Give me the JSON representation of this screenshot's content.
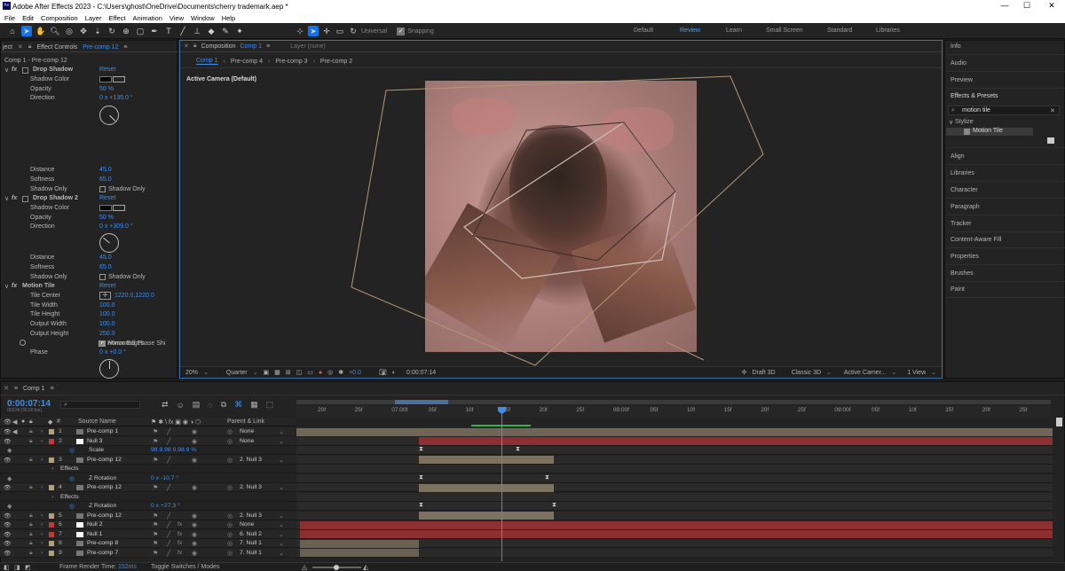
{
  "window": {
    "app_logo": "Ae",
    "title": "Adobe After Effects 2023 - C:\\Users\\ghost\\OneDrive\\Documents\\cherry trademark.aep *",
    "minimize": "—",
    "maximize": "☐",
    "close": "✕"
  },
  "menu": [
    "File",
    "Edit",
    "Composition",
    "Layer",
    "Effect",
    "Animation",
    "View",
    "Window",
    "Help"
  ],
  "toolbar": {
    "universal": "Universal",
    "snapping": "Snapping"
  },
  "workspaces": [
    "Default",
    "Review",
    "Learn",
    "Small Screen",
    "Standard",
    "Libraries"
  ],
  "project_tab": "ject",
  "effect_controls": {
    "tab_label": "Effect Controls",
    "tab_target": "Pre-comp 12",
    "breadcrumb": "Comp 1 - Pre-comp 12",
    "drop_shadow": {
      "name": "Drop Shadow",
      "reset": "Reset",
      "shadow_color": "Shadow Color",
      "opacity": "Opacity",
      "opacity_val": "50 %",
      "direction": "Direction",
      "direction_val": "0 x +135.0 °",
      "distance": "Distance",
      "distance_val": "45.0",
      "softness": "Softness",
      "softness_val": "65.0",
      "shadow_only": "Shadow Only",
      "shadow_only_cb": "Shadow Only"
    },
    "drop_shadow2": {
      "name": "Drop Shadow 2",
      "reset": "Reset",
      "shadow_color": "Shadow Color",
      "opacity": "Opacity",
      "opacity_val": "50 %",
      "direction": "Direction",
      "direction_val": "0 x +309.0 °",
      "distance": "Distance",
      "distance_val": "45.0",
      "softness": "Softness",
      "softness_val": "65.0",
      "shadow_only": "Shadow Only",
      "shadow_only_cb": "Shadow Only"
    },
    "motion_tile": {
      "name": "Motion Tile",
      "reset": "Reset",
      "tile_center": "Tile Center",
      "tile_center_val": "1220.0,1220.0",
      "tile_width": "Tile Width",
      "tile_width_val": "100.0",
      "tile_height": "Tile Height",
      "tile_height_val": "100.0",
      "output_width": "Output Width",
      "output_width_val": "100.0",
      "output_height": "Output Height",
      "output_height_val": "250.0",
      "mirror_edges": "Mirror Edges",
      "phase": "Phase",
      "phase_val": "0 x +0.0 °",
      "horiz_phase": "Horizontal Phase Shi"
    }
  },
  "composition": {
    "tab_label": "Composition",
    "tab_target": "Comp 1",
    "layer_tab": "Layer (none)",
    "nav": [
      "Comp 1",
      "Pre-comp 4",
      "Pre-comp 3",
      "Pre-comp 2"
    ],
    "camera_label": "Active Camera (Default)",
    "footer": {
      "zoom": "20%",
      "resolution": "Quarter",
      "exposure": "+0.0",
      "timecode": "0:00:07:14",
      "draft3d": "Draft 3D",
      "renderer": "Classic 3D",
      "camera": "Active Camer...",
      "view": "1 View"
    }
  },
  "right_panel": {
    "info": "Info",
    "audio": "Audio",
    "preview": "Preview",
    "effects_presets": "Effects & Presets",
    "search_value": "motion tile",
    "category": "Stylize",
    "result": "Motion Tile",
    "items": [
      "Align",
      "Libraries",
      "Character",
      "Paragraph",
      "Tracker",
      "Content-Aware Fill",
      "Properties",
      "Brushes",
      "Paint"
    ]
  },
  "timeline": {
    "tab": "Comp 1",
    "timecode": "0:00:07:14",
    "fps": "00224 (30.00 fps)",
    "col_source": "Source Name",
    "col_parent": "Parent & Link",
    "ruler": [
      "20f",
      "25f",
      "07:00f",
      "05f",
      "10f",
      "15f",
      "20f",
      "25f",
      "08:00f",
      "05f",
      "10f",
      "15f",
      "20f",
      "25f",
      "09:00f",
      "05f",
      "10f",
      "15f",
      "20f",
      "25f"
    ],
    "layers": [
      {
        "num": "1",
        "name": "Pre-comp 1",
        "parent": "None",
        "label": "#b0a07e",
        "type": "comp"
      },
      {
        "num": "2",
        "name": "Null 3",
        "parent": "None",
        "label": "#c0393b",
        "type": "null"
      },
      {
        "num": "",
        "name": "Scale",
        "value": "98.9,98.9,98.9 %",
        "type": "prop"
      },
      {
        "num": "3",
        "name": "Pre-comp 12",
        "parent": "2. Null 3",
        "label": "#b0a07e",
        "type": "comp"
      },
      {
        "num": "",
        "name": "Effects",
        "type": "group"
      },
      {
        "num": "",
        "name": "Z Rotation",
        "value": "0 x -10.7 °",
        "type": "prop"
      },
      {
        "num": "4",
        "name": "Pre-comp 12",
        "parent": "2. Null 3",
        "label": "#b0a07e",
        "type": "comp"
      },
      {
        "num": "",
        "name": "Effects",
        "type": "group"
      },
      {
        "num": "",
        "name": "Z Rotation",
        "value": "0 x +27.3 °",
        "type": "prop"
      },
      {
        "num": "5",
        "name": "Pre-comp 12",
        "parent": "2. Null 3",
        "label": "#b0a07e",
        "type": "comp"
      },
      {
        "num": "6",
        "name": "Null 2",
        "parent": "None",
        "label": "#c0393b",
        "type": "null"
      },
      {
        "num": "7",
        "name": "Null 1",
        "parent": "6. Null 2",
        "label": "#c0393b",
        "type": "null"
      },
      {
        "num": "8",
        "name": "Pre-comp 8",
        "parent": "7. Null 1",
        "label": "#b0a07e",
        "type": "comp"
      },
      {
        "num": "9",
        "name": "Pre-comp 7",
        "parent": "7. Null 1",
        "label": "#b0a07e",
        "type": "comp"
      }
    ],
    "footer": {
      "render_label": "Frame Render Time:",
      "render_value": "152ms",
      "toggle": "Toggle Switches / Modes"
    }
  },
  "colors": {
    "accent": "#3d8ff0",
    "null_bar": "#8e2f31",
    "comp_bar": "#6b6152",
    "ui_bg": "#232323"
  }
}
